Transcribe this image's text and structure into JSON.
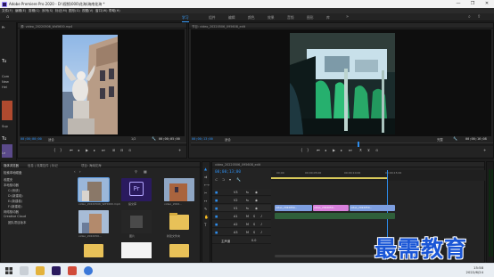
{
  "window": {
    "title": "Adobe Premiere Pro 2020 - D:\\视频\\000\\花海\\海南花海 *",
    "controls": [
      "—",
      "❐",
      "✕"
    ]
  },
  "menu": [
    "文件(F)",
    "编辑(E)",
    "剪辑(C)",
    "序列(S)",
    "标记(M)",
    "图形(G)",
    "视图(V)",
    "窗口(W)",
    "帮助(H)"
  ],
  "workspaces": {
    "active": "学习",
    "items": [
      "组件",
      "编辑",
      "颜色",
      "效果",
      "音频",
      "图形",
      "库"
    ]
  },
  "sidebar_left": {
    "items": [
      "Pr",
      "Tu",
      "Com",
      "New",
      "Hel",
      "Sup",
      "Tu",
      "Le"
    ]
  },
  "source": {
    "tab": "源: video_20220506_Wd5600.mp4",
    "timecode_in": "00;00;00;00",
    "fit": "适合",
    "ratio": "1/2",
    "timecode_out": "00;00;05;00"
  },
  "program": {
    "tab": "节目: video_20220506_095608_edit",
    "timecode_in": "00;00;13;00",
    "fit": "适合",
    "ratio": "完整",
    "timecode_out": "00;00;16;08"
  },
  "project": {
    "tabs": [
      "媒体浏览器",
      "信息 | 效果控件 | 标记",
      "项目: 海南花海"
    ],
    "location": "检索本地磁盘",
    "tree": [
      "收藏夹",
      "本地驱动器",
      "C:(系统)",
      "D:(新建卷)",
      "E:(新建卷)",
      "F:(新建卷)",
      "网络驱动器",
      "Creative Cloud",
      "团队项目版本"
    ],
    "items": [
      {
        "label": "video_20220506_Wd5600.mp4",
        "kind": "video-street"
      },
      {
        "label": "提交库",
        "kind": "premiere"
      },
      {
        "label": "video_2022...",
        "kind": "video-street2"
      },
      {
        "label": "video_2022050...",
        "kind": "video-street3"
      },
      {
        "label": "图片",
        "kind": "image-dark"
      },
      {
        "label": "新建文件夹",
        "kind": "folder"
      },
      {
        "label": "",
        "kind": "folder"
      }
    ]
  },
  "timeline": {
    "tab": "video_20220506_095608_edit",
    "timecode": "00;00;13;00",
    "ruler_ticks": [
      "00;00",
      "00;00;05;00",
      "00;00;10;00",
      "00;00;15;00"
    ],
    "tracks": [
      "V3",
      "V2",
      "V1",
      "A1",
      "A2",
      "A3"
    ],
    "master": "主声道",
    "master_value": "0.0",
    "clips": [
      {
        "label": "video_2022050...",
        "color": "#6b8fd6"
      },
      {
        "label": "video_2022050...",
        "color": "#d06bd4"
      },
      {
        "label": "video_2022050...",
        "color": "#6b8fd6"
      }
    ]
  },
  "taskbar": {
    "time": "15:58",
    "date": "2022/6/24"
  },
  "watermark": "最需教育"
}
